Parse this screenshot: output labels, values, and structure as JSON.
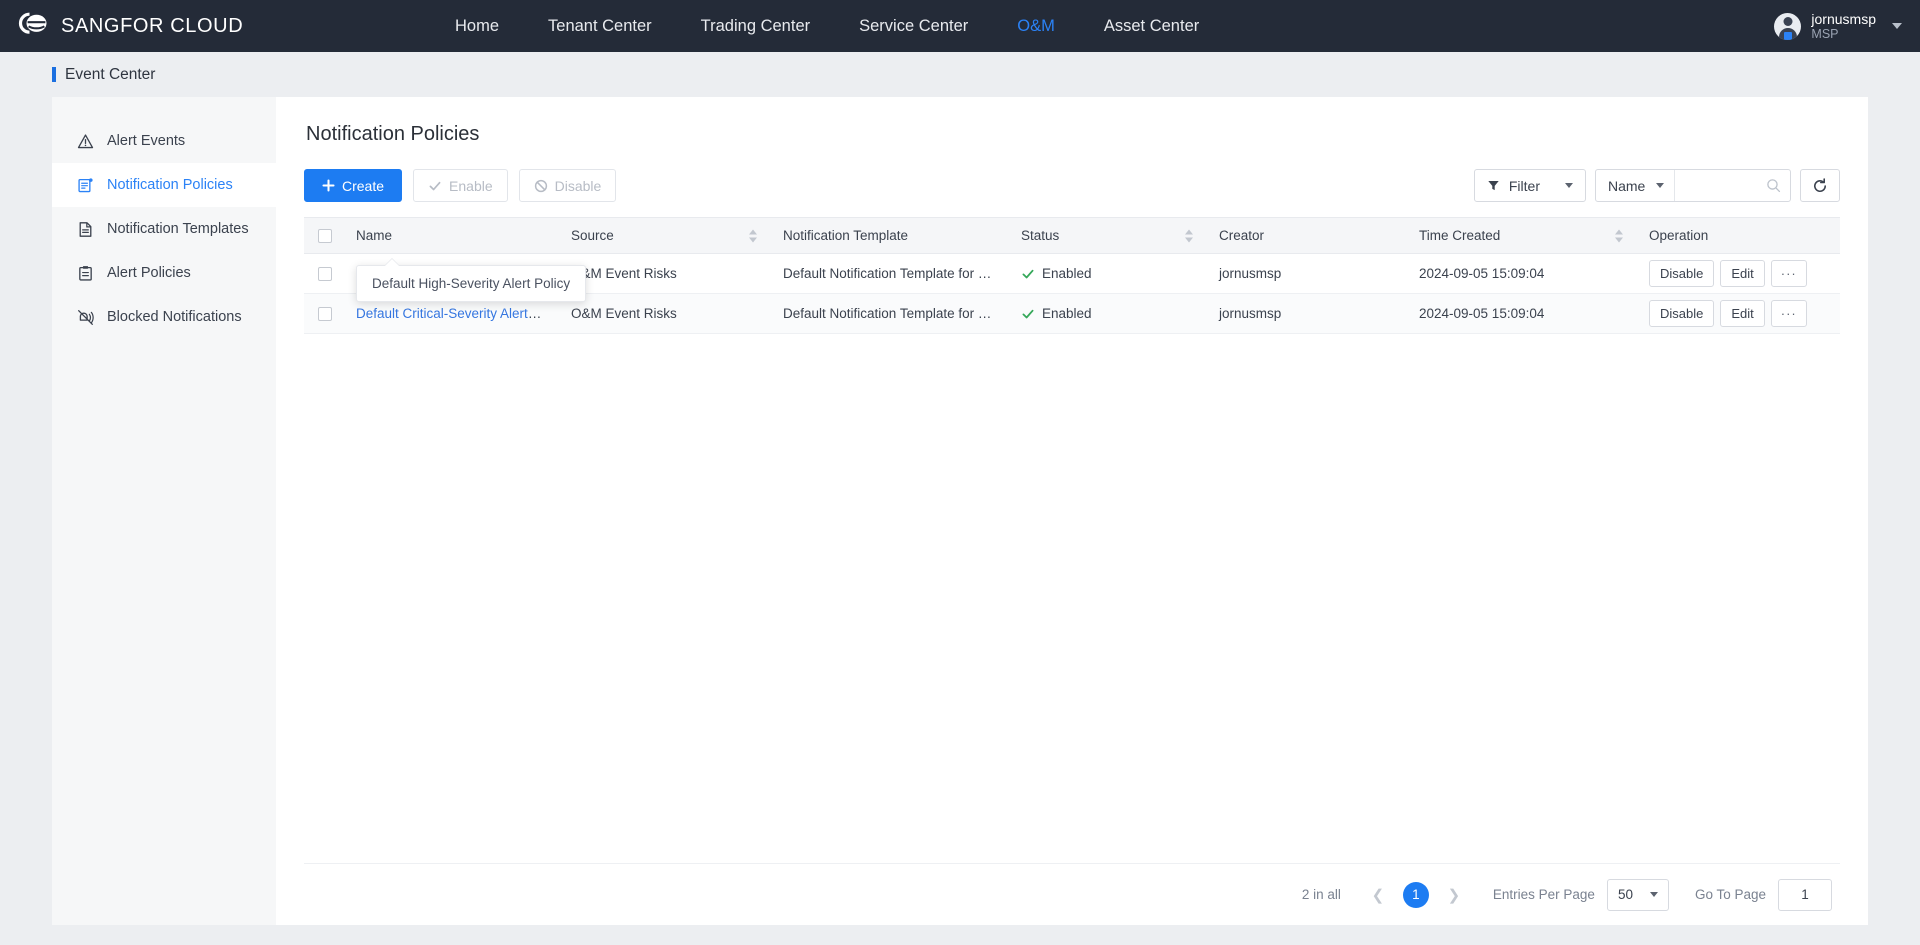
{
  "brand": {
    "name": "SANGFOR CLOUD",
    "logo_icon": "cloud-logo-icon"
  },
  "topnav": {
    "items": [
      {
        "label": "Home",
        "active": false
      },
      {
        "label": "Tenant Center",
        "active": false
      },
      {
        "label": "Trading Center",
        "active": false
      },
      {
        "label": "Service Center",
        "active": false
      },
      {
        "label": "O&M",
        "active": true
      },
      {
        "label": "Asset Center",
        "active": false
      }
    ],
    "active_color": "#2b82f6"
  },
  "user": {
    "name": "jornusmsp",
    "role": "MSP",
    "avatar_icon": "avatar-icon",
    "caret_icon": "chevron-down-icon"
  },
  "breadcrumb": {
    "text": "Event Center",
    "accent_color": "#1b6fe0"
  },
  "sidebar": {
    "items": [
      {
        "label": "Alert Events",
        "icon": "warning-triangle-icon",
        "active": false
      },
      {
        "label": "Notification Policies",
        "icon": "notification-policy-icon",
        "active": true
      },
      {
        "label": "Notification Templates",
        "icon": "document-icon",
        "active": false
      },
      {
        "label": "Alert Policies",
        "icon": "clipboard-icon",
        "active": false
      },
      {
        "label": "Blocked Notifications",
        "icon": "bell-muted-icon",
        "active": false
      }
    ]
  },
  "page": {
    "title": "Notification Policies"
  },
  "toolbar": {
    "create_label": "Create",
    "create_icon": "plus-icon",
    "enable_label": "Enable",
    "enable_icon": "check-icon",
    "enable_disabled": true,
    "disable_label": "Disable",
    "disable_icon": "ban-icon",
    "disable_disabled": true,
    "filter_label": "Filter",
    "filter_icon": "funnel-icon",
    "search_field": "Name",
    "search_value": "",
    "search_placeholder": "",
    "search_icon": "search-icon",
    "refresh_icon": "refresh-icon"
  },
  "table": {
    "columns": [
      {
        "label": "Name",
        "sortable": false
      },
      {
        "label": "Source",
        "sortable": true
      },
      {
        "label": "Notification Template",
        "sortable": false
      },
      {
        "label": "Status",
        "sortable": true
      },
      {
        "label": "Creator",
        "sortable": false
      },
      {
        "label": "Time Created",
        "sortable": true
      },
      {
        "label": "Operation",
        "sortable": false
      }
    ],
    "rows": [
      {
        "name": "Default High-Severity Alert Policy",
        "source": "O&M Event Risks",
        "template": "Default Notification Template for High-S...",
        "status": "Enabled",
        "status_icon": "check-icon",
        "creator": "jornusmsp",
        "time_created": "2024-09-05 15:09:04",
        "ops": [
          "Disable",
          "Edit",
          "···"
        ]
      },
      {
        "name": "Default Critical-Severity Alert Policy",
        "source": "O&M Event Risks",
        "template": "Default Notification Template for Critical...",
        "status": "Enabled",
        "status_icon": "check-icon",
        "creator": "jornusmsp",
        "time_created": "2024-09-05 15:09:04",
        "ops": [
          "Disable",
          "Edit",
          "···"
        ]
      }
    ],
    "status_color": "#36a85a"
  },
  "tooltip": {
    "text": "Default High-Severity Alert Policy"
  },
  "pagination": {
    "total_text": "2 in all",
    "prev_icon": "chevron-left-icon",
    "next_icon": "chevron-right-icon",
    "current_page": "1",
    "entries_label": "Entries Per Page",
    "entries_value": "50",
    "goto_label": "Go To Page",
    "goto_value": "1"
  }
}
